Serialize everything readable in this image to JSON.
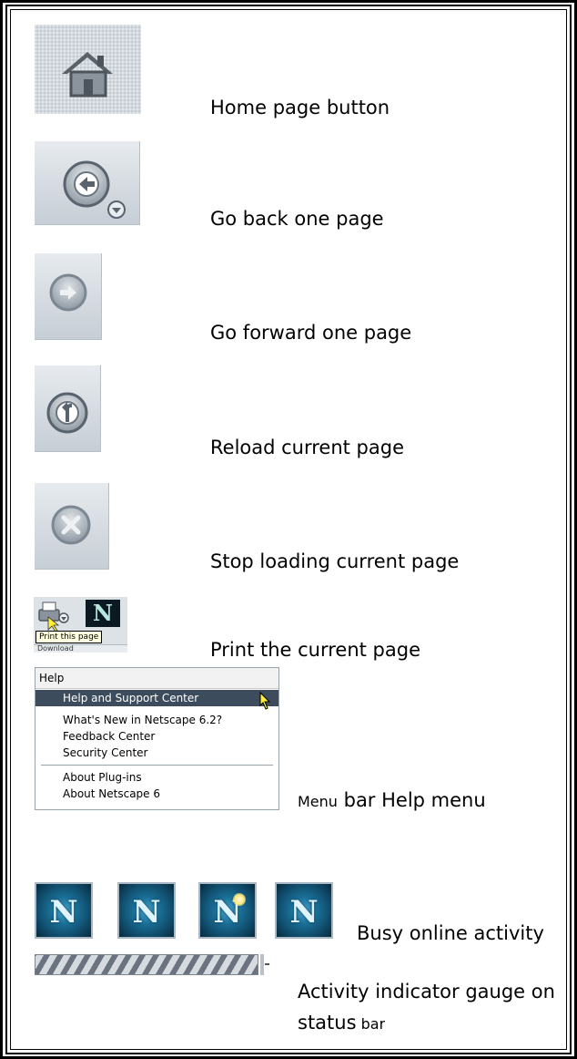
{
  "items": [
    {
      "caption": "Home page button",
      "icon": "home-icon"
    },
    {
      "caption": "Go back one page",
      "icon": "back-arrow-icon"
    },
    {
      "caption": "Go forward one page",
      "icon": "forward-arrow-icon"
    },
    {
      "caption": "Reload current page",
      "icon": "reload-icon"
    },
    {
      "caption": "Stop loading current page",
      "icon": "stop-icon"
    },
    {
      "caption": "Print the current page",
      "icon": "print-icon"
    },
    {
      "caption_small": "Menu",
      "caption_rest": " bar Help menu"
    },
    {
      "caption": "Busy online activity",
      "icon": "netscape-n-icon"
    },
    {
      "caption_line1": "Activity indicator gauge on",
      "caption_line2_main": "status",
      "caption_line2_small": " bar"
    }
  ],
  "print_snippet": {
    "n_letter": "N",
    "tooltip": "Print this page",
    "strip_text": "Download"
  },
  "help_menu": {
    "title": "Help",
    "items": [
      "Help and Support Center",
      "What's New in Netscape 6.2?",
      "Feedback Center",
      "Security Center",
      "About Plug-ins",
      "About Netscape 6"
    ]
  },
  "activity_tiles": [
    "N",
    "N",
    "N",
    "N"
  ],
  "colors": {
    "frame": "#000000",
    "menu_highlight": "#3c4c5c",
    "tooltip": "#ffffe1",
    "tile_blue": "#1a6f97"
  }
}
